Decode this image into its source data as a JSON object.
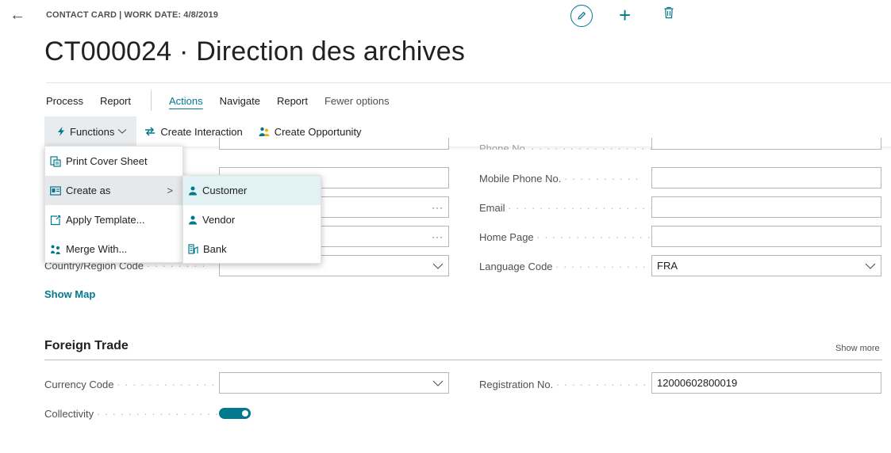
{
  "header": {
    "caption": "CONTACT CARD | WORK DATE: 4/8/2019",
    "title": "CT000024 · Direction des archives"
  },
  "nav": {
    "process": "Process",
    "report1": "Report",
    "actions": "Actions",
    "navigate": "Navigate",
    "report2": "Report",
    "fewer": "Fewer options"
  },
  "actionbar": {
    "functions": "Functions",
    "create_interaction": "Create Interaction",
    "create_opportunity": "Create Opportunity"
  },
  "functions_menu": {
    "print_cover_sheet": "Print Cover Sheet",
    "create_as": "Create as",
    "apply_template": "Apply Template...",
    "merge_with": "Merge With..."
  },
  "create_as_menu": {
    "customer": "Customer",
    "vendor": "Vendor",
    "bank": "Bank"
  },
  "address": {
    "country_region_label": "Country/Region Code",
    "show_map": "Show Map"
  },
  "communication": {
    "phone_label": "Phone No.",
    "mobile_label": "Mobile Phone No.",
    "email_label": "Email",
    "homepage_label": "Home Page",
    "language_label": "Language Code",
    "language_value": "FRA"
  },
  "foreign_trade": {
    "title": "Foreign Trade",
    "show_more": "Show more",
    "currency_label": "Currency Code",
    "registration_label": "Registration No.",
    "registration_value": "12000602800019",
    "collectivity_label": "Collectivity",
    "collectivity_on": true
  },
  "colors": {
    "accent": "#00798f",
    "menu_highlight": "#e1f1f4"
  },
  "icons": [
    "back-arrow-icon",
    "pencil-icon",
    "plus-icon",
    "trash-icon",
    "lightning-icon",
    "chevron-down-icon",
    "interaction-icon",
    "opportunity-icon",
    "print-icon",
    "card-icon",
    "template-icon",
    "merge-icon",
    "chevron-right-icon",
    "person-icon",
    "bank-icon"
  ]
}
